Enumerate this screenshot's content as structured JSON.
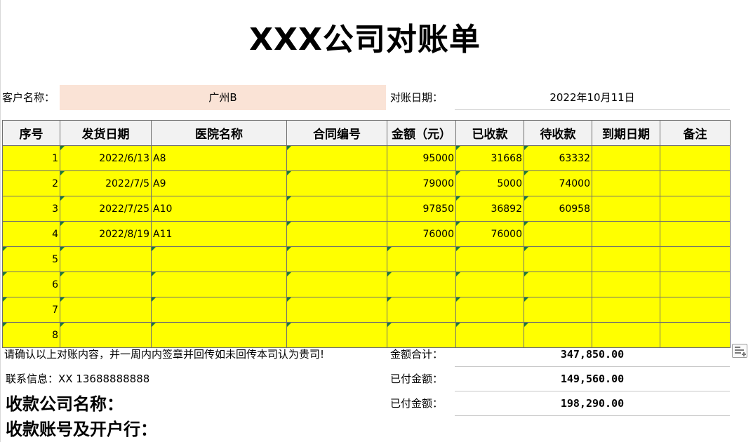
{
  "title": "XXX公司对账单",
  "customer": {
    "label": "客户名称：",
    "value": "广州B"
  },
  "statement_date": {
    "label": "对账日期：",
    "value": "2022年10月11日"
  },
  "table": {
    "headers": [
      "序号",
      "发货日期",
      "医院名称",
      "合同编号",
      "金额（元）",
      "已收款",
      "待收款",
      "到期日期",
      "备注"
    ],
    "rows": [
      [
        "1",
        "2022/6/13",
        "A8",
        "",
        "95000",
        "31668",
        "63332",
        "",
        ""
      ],
      [
        "2",
        "2022/7/5",
        "A9",
        "",
        "79000",
        "5000",
        "74000",
        "",
        ""
      ],
      [
        "3",
        "2022/7/25",
        "A10",
        "",
        "97850",
        "36892",
        "60958",
        "",
        ""
      ],
      [
        "4",
        "2022/8/19",
        "A11",
        "",
        "76000",
        "76000",
        "",
        "",
        ""
      ],
      [
        "5",
        "",
        "",
        "",
        "",
        "",
        "",
        "",
        ""
      ],
      [
        "6",
        "",
        "",
        "",
        "",
        "",
        "",
        "",
        ""
      ],
      [
        "7",
        "",
        "",
        "",
        "",
        "",
        "",
        "",
        ""
      ],
      [
        "8",
        "",
        "",
        "",
        "",
        "",
        "",
        "",
        ""
      ]
    ]
  },
  "note": "请确认以上对账内容，并一周内内签章并回传如未回传本司认为贵司!",
  "contact": "联系信息：XX    13688888888",
  "payee_company": "收款公司名称：",
  "payee_account": "收款账号及开户行：",
  "totals": [
    {
      "label": "金额合计：",
      "value": "347,850.00"
    },
    {
      "label": "已付金额：",
      "value": "149,560.00"
    },
    {
      "label": "已付金额：",
      "value": "198,290.00"
    }
  ],
  "colors": {
    "highlight": "#ffff00",
    "customer_fill": "#fae3d6",
    "header_fill": "#f2f2f2",
    "cell_marker": "#1e7b36"
  },
  "icons": {
    "paste_options": "paste-options-icon"
  }
}
